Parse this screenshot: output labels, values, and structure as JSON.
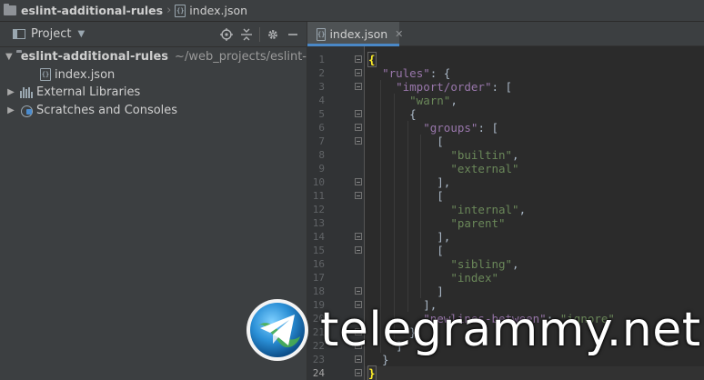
{
  "breadcrumb": {
    "project": "eslint-additional-rules",
    "file": "index.json"
  },
  "project_panel": {
    "title": "Project",
    "tree": {
      "root_name": "eslint-additional-rules",
      "root_path": "~/web_projects/eslint-a",
      "file": "index.json",
      "libraries": "External Libraries",
      "scratches": "Scratches and Consoles"
    }
  },
  "editor": {
    "tab_label": "index.json",
    "lines": [
      [
        [
          "bh",
          "{"
        ]
      ],
      [
        [
          "p",
          "  "
        ],
        [
          "k",
          "\"rules\""
        ],
        [
          "p",
          ": {"
        ]
      ],
      [
        [
          "p",
          "    "
        ],
        [
          "k",
          "\"import/order\""
        ],
        [
          "p",
          ": ["
        ]
      ],
      [
        [
          "p",
          "      "
        ],
        [
          "s",
          "\"warn\""
        ],
        [
          "p",
          ","
        ]
      ],
      [
        [
          "p",
          "      {"
        ]
      ],
      [
        [
          "p",
          "        "
        ],
        [
          "k",
          "\"groups\""
        ],
        [
          "p",
          ": ["
        ]
      ],
      [
        [
          "p",
          "          ["
        ]
      ],
      [
        [
          "p",
          "            "
        ],
        [
          "s",
          "\"builtin\""
        ],
        [
          "p",
          ","
        ]
      ],
      [
        [
          "p",
          "            "
        ],
        [
          "s",
          "\"external\""
        ]
      ],
      [
        [
          "p",
          "          ],"
        ]
      ],
      [
        [
          "p",
          "          ["
        ]
      ],
      [
        [
          "p",
          "            "
        ],
        [
          "s",
          "\"internal\""
        ],
        [
          "p",
          ","
        ]
      ],
      [
        [
          "p",
          "            "
        ],
        [
          "s",
          "\"parent\""
        ]
      ],
      [
        [
          "p",
          "          ],"
        ]
      ],
      [
        [
          "p",
          "          ["
        ]
      ],
      [
        [
          "p",
          "            "
        ],
        [
          "s",
          "\"sibling\""
        ],
        [
          "p",
          ","
        ]
      ],
      [
        [
          "p",
          "            "
        ],
        [
          "s",
          "\"index\""
        ]
      ],
      [
        [
          "p",
          "          ]"
        ]
      ],
      [
        [
          "p",
          "        ],"
        ]
      ],
      [
        [
          "p",
          "        "
        ],
        [
          "k",
          "\"newlines-between\""
        ],
        [
          "p",
          ": "
        ],
        [
          "s",
          "\"ignore\""
        ]
      ],
      [
        [
          "p",
          "      }"
        ]
      ],
      [
        [
          "p",
          "    ]"
        ]
      ],
      [
        [
          "p",
          "  }"
        ]
      ],
      [
        [
          "bh",
          "}"
        ]
      ]
    ],
    "current_line": 24
  },
  "watermark": {
    "text": "telegrammy.net"
  }
}
